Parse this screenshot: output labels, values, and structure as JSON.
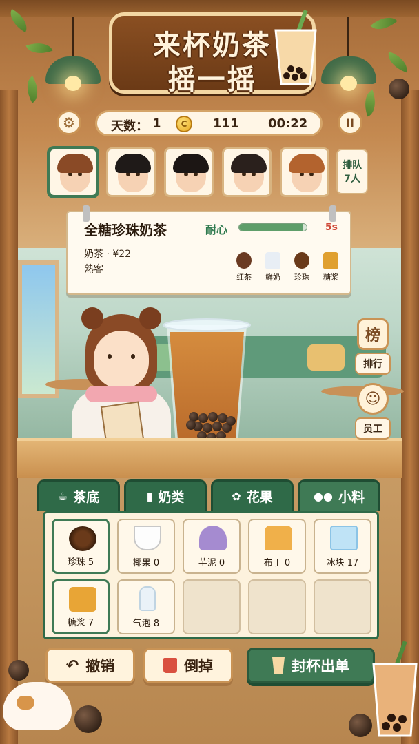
{
  "title": {
    "line1": "来杯奶茶",
    "line2": "摇一摇"
  },
  "stats": {
    "day_label": "天数：",
    "day": "1",
    "coins": "111",
    "timer": "00:22"
  },
  "buttons": {
    "settings_icon": "⚙",
    "pause_icon": "II"
  },
  "queue": {
    "badge_line1": "排队",
    "badge_line2": "7人",
    "customers": [
      {
        "name": "customer-1",
        "hair": "#8a4a26"
      },
      {
        "name": "customer-2",
        "hair": "#1f1a18"
      },
      {
        "name": "customer-3",
        "hair": "#1c1614"
      },
      {
        "name": "customer-4",
        "hair": "#2a201c"
      },
      {
        "name": "customer-5",
        "hair": "#b3632e"
      }
    ]
  },
  "order": {
    "name": "全糖珍珠奶茶",
    "patience_label": "耐心",
    "patience_level": 0.95,
    "time_left": "5s",
    "category_price": "奶茶 · ¥22",
    "customer_type": "熟客",
    "ingredients": [
      {
        "label": "红茶",
        "icon": "black-tea-icon",
        "color": "#6a3a22"
      },
      {
        "label": "鲜奶",
        "icon": "milk-bottle-icon",
        "color": "#e8eef5"
      },
      {
        "label": "珍珠",
        "icon": "pearls-icon",
        "color": "#6a3a1a"
      },
      {
        "label": "糖浆",
        "icon": "syrup-icon",
        "color": "#e0a030"
      }
    ]
  },
  "side": {
    "rank_icon": "榜",
    "rank_label": "排行",
    "staff_icon": "☺",
    "staff_label": "员工"
  },
  "tabs": [
    {
      "label": "茶底",
      "icon": "☕"
    },
    {
      "label": "奶类",
      "icon": "▮"
    },
    {
      "label": "花果",
      "icon": "✿"
    },
    {
      "label": "小料",
      "icon": "●●"
    }
  ],
  "slots": [
    {
      "label": "珍珠 5",
      "icon": "pearls-icon"
    },
    {
      "label": "椰果 0",
      "icon": "coconut-jelly-icon"
    },
    {
      "label": "芋泥 0",
      "icon": "taro-paste-icon"
    },
    {
      "label": "布丁 0",
      "icon": "pudding-icon"
    },
    {
      "label": "冰块 17",
      "icon": "ice-cubes-icon"
    },
    {
      "label": "糖浆 7",
      "icon": "syrup-bottle-icon"
    },
    {
      "label": "气泡 8",
      "icon": "soda-bottle-icon"
    },
    {
      "label": "",
      "icon": ""
    },
    {
      "label": "",
      "icon": ""
    },
    {
      "label": "",
      "icon": ""
    }
  ],
  "actions": {
    "undo": "撤销",
    "pour": "倒掉",
    "serve": "封杯出单"
  },
  "colors": {
    "accent_green": "#3f7a55",
    "wood": "#c48950",
    "cream": "#fff6e6"
  }
}
